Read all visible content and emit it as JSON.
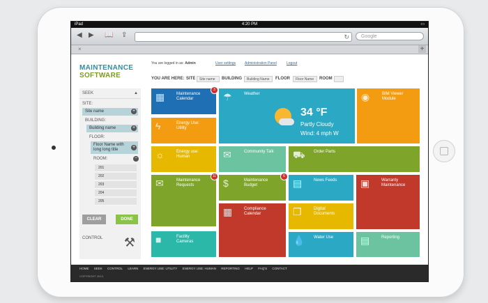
{
  "status": {
    "device": "iPad",
    "time": "4:20 PM"
  },
  "browser": {
    "search_placeholder": "Google",
    "close_tab": "×",
    "new_tab": "+"
  },
  "logo": {
    "line1": "MAINTENANCE",
    "line2": "SOFTWARE"
  },
  "header": {
    "logged_in_prefix": "You are logged in as:",
    "user": "Admin",
    "links": [
      "User settings",
      "Administration Panel",
      "Logout"
    ]
  },
  "breadcrumb": {
    "prefix": "YOU ARE HERE:",
    "site_label": "SITE",
    "site_value": "Site name",
    "building_label": "BUILDING",
    "building_value": "Building Name",
    "floor_label": "FLOOR",
    "floor_value": "Floor Name",
    "room_label": "ROOM",
    "room_value": ""
  },
  "sidebar": {
    "seek": "SEEK",
    "site_label": "SITE:",
    "site_value": "Site name",
    "building_label": "BUILDING:",
    "building_value": "Building name",
    "floor_label": "FLOOR:",
    "floor_value_1": "Floor Name with",
    "floor_value_2": "long long title",
    "room_label": "ROOM:",
    "rooms": [
      "201",
      "202",
      "203",
      "204",
      "205"
    ],
    "clear": "CLEAR",
    "done": "DONE",
    "control": "CONTROL"
  },
  "tiles": {
    "maint_cal": {
      "l1": "Maintenance",
      "l2": "Calendar",
      "badge": "3"
    },
    "weather": {
      "title": "Weather",
      "temp": "34 °F",
      "desc": "Partly Cloudy",
      "wind": "Wind: 4 mph W"
    },
    "bim": {
      "l1": "BIM Viewer",
      "l2": "Module"
    },
    "energy_utility": {
      "l1": "Energy Use:",
      "l2": "Utility"
    },
    "energy_human": {
      "l1": "Energy use:",
      "l2": "Human"
    },
    "community": {
      "l1": "Community Talk"
    },
    "order_parts": {
      "l1": "Order Parts"
    },
    "maint_req": {
      "l1": "Maintenance",
      "l2": "Requests",
      "badge": "11"
    },
    "maint_budget": {
      "l1": "Maintenance",
      "l2": "Budget",
      "badge": "6"
    },
    "news": {
      "l1": "News Feeds"
    },
    "warranty": {
      "l1": "Warranty",
      "l2": "Maintenance"
    },
    "compliance": {
      "l1": "Compliance",
      "l2": "Calendar"
    },
    "digital_docs": {
      "l1": "Digital",
      "l2": "Documents"
    },
    "facility": {
      "l1": "Facility",
      "l2": "Cameras"
    },
    "water": {
      "l1": "Water Use"
    },
    "reporting": {
      "l1": "Reporting"
    }
  },
  "footer": {
    "links": [
      "HOME",
      "SEEK",
      "CONTROL",
      "LEARN",
      "ENERGY USE: UTILITY",
      "ENERGY USE: HUMAN",
      "REPORTING",
      "HELP",
      "FAQ'S",
      "CONTACT"
    ],
    "copyright": "COPYRIGHT 2013,"
  },
  "colors": {
    "blue": "#1f6fb5",
    "teal": "#2ba8c4",
    "orange": "#f39c12",
    "yellow": "#e6b800",
    "mint": "#6cc3a0",
    "green": "#7ea52a",
    "red": "#c0392b"
  }
}
